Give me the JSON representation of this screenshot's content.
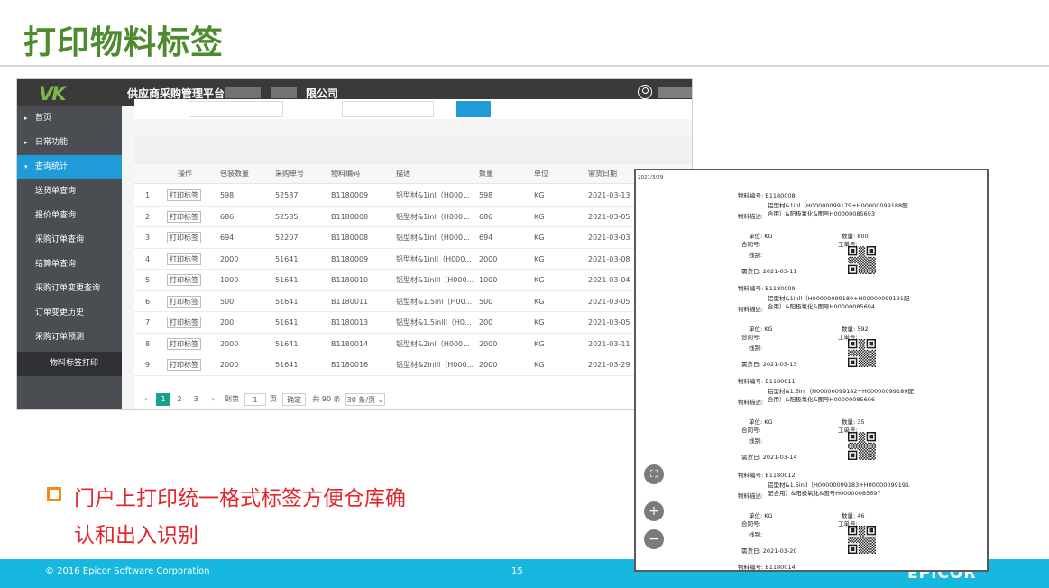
{
  "slide": {
    "title": "打印物料标签",
    "bullet_line1": "门户上打印统一格式标签方便仓库确",
    "bullet_line2": "认和出入识别",
    "copyright": "© 2016 Epicor Software Corporation",
    "page_number": "15",
    "brand": "EPICOR"
  },
  "portal": {
    "logo": "VK",
    "title": "供应商采购管理平台",
    "title_suffix": "限公司",
    "sidebar": [
      {
        "label": "首页",
        "caret": "▸"
      },
      {
        "label": "日常功能",
        "caret": "▸"
      },
      {
        "label": "查询统计",
        "caret": "▾"
      },
      {
        "label": "送货单查询"
      },
      {
        "label": "报价单查询"
      },
      {
        "label": "采购订单查询"
      },
      {
        "label": "结算单查询"
      },
      {
        "label": "采购订单变更查询"
      },
      {
        "label": "订单变更历史"
      },
      {
        "label": "采购订单预测"
      },
      {
        "label": "物料标签打印"
      }
    ],
    "columns": [
      "操作",
      "包装数量",
      "采购单号",
      "物料编码",
      "描述",
      "数量",
      "单位",
      "需货日期"
    ],
    "print_button": "打印标签",
    "rows": [
      {
        "no": "1",
        "pack": "598",
        "po": "52587",
        "part": "B1180009",
        "desc": "铝型材&1inl（H000...",
        "qty": "598",
        "uom": "KG",
        "date": "2021-03-13"
      },
      {
        "no": "2",
        "pack": "686",
        "po": "52585",
        "part": "B1180008",
        "desc": "铝型材&1inl（H000...",
        "qty": "686",
        "uom": "KG",
        "date": "2021-03-05"
      },
      {
        "no": "3",
        "pack": "694",
        "po": "52207",
        "part": "B1180008",
        "desc": "铝型材&1inl（H000...",
        "qty": "694",
        "uom": "KG",
        "date": "2021-03-03"
      },
      {
        "no": "4",
        "pack": "2000",
        "po": "51641",
        "part": "B1180009",
        "desc": "铝型材&1inll（H000...",
        "qty": "2000",
        "uom": "KG",
        "date": "2021-03-08"
      },
      {
        "no": "5",
        "pack": "1000",
        "po": "51641",
        "part": "B1180010",
        "desc": "铝型材&1inlll（H000...",
        "qty": "1000",
        "uom": "KG",
        "date": "2021-03-04"
      },
      {
        "no": "6",
        "pack": "500",
        "po": "51641",
        "part": "B1180011",
        "desc": "铝型材&1.5inl（H00...",
        "qty": "500",
        "uom": "KG",
        "date": "2021-03-05"
      },
      {
        "no": "7",
        "pack": "200",
        "po": "51641",
        "part": "B1180013",
        "desc": "铝型材&1.5inlll（H0...",
        "qty": "200",
        "uom": "KG",
        "date": "2021-03-05"
      },
      {
        "no": "8",
        "pack": "2000",
        "po": "51641",
        "part": "B1180014",
        "desc": "铝型材&2inl（H000...",
        "qty": "2000",
        "uom": "KG",
        "date": "2021-03-11"
      },
      {
        "no": "9",
        "pack": "2000",
        "po": "51641",
        "part": "B1180016",
        "desc": "铝型材&2inlll（H000...",
        "qty": "2000",
        "uom": "KG",
        "date": "2021-03-29"
      }
    ],
    "pager": {
      "prev": "‹",
      "pages": [
        "1",
        "2",
        "3"
      ],
      "next": "›",
      "goto_label": "到第",
      "goto_value": "1",
      "page_unit": "页",
      "confirm": "确定",
      "total": "共 90 条",
      "page_size": "30 条/页 ⌄"
    }
  },
  "preview": {
    "date": "2021/3/29",
    "labels": {
      "part": "物料编号:",
      "desc": "物料描述:",
      "uom": "单位:",
      "contract": "合同号:",
      "line": "线别:",
      "qty": "数量:",
      "work_order": "工单号:",
      "need_date": "需货日:"
    },
    "items": [
      {
        "part": "B1180008",
        "desc1": "铝型材&1inl（H00000099179+H00000099188配",
        "desc2": "合用）&阳极氧化&图号H00000085693",
        "uom": "KG",
        "qty": "800",
        "date": "2021-03-11"
      },
      {
        "part": "B1180009",
        "desc1": "铝型材&1inll（H00000099180+H00000099191配",
        "desc2": "合用）&阳极氧化&图号H00000085694",
        "uom": "KG",
        "qty": "592",
        "date": "2021-03-13"
      },
      {
        "part": "B1180011",
        "desc1": "铝型材&1.5inl（H00000099182+H00000099189配",
        "desc2": "合用）&阳极氧化&图号H00000085696",
        "uom": "KG",
        "qty": "35",
        "date": "2021-03-14"
      },
      {
        "part": "B1180012",
        "desc1": "铝型材&1.5inll（H00000099183+H00000099191",
        "desc2": "配合用）&阳极氧化&图号H00000085697",
        "uom": "KG",
        "qty": "46",
        "date": "2021-03-20"
      }
    ],
    "last_part": "B1180014",
    "tools": [
      "⛶",
      "+",
      "−"
    ]
  },
  "colors": {
    "title_green": "#4e8a2e",
    "footer_blue": "#16b8df",
    "bullet_red": "#e3262c",
    "bullet_orange": "#f28b1a",
    "sidebar_active": "#1f9cd8",
    "page_current": "#1aa18b"
  }
}
